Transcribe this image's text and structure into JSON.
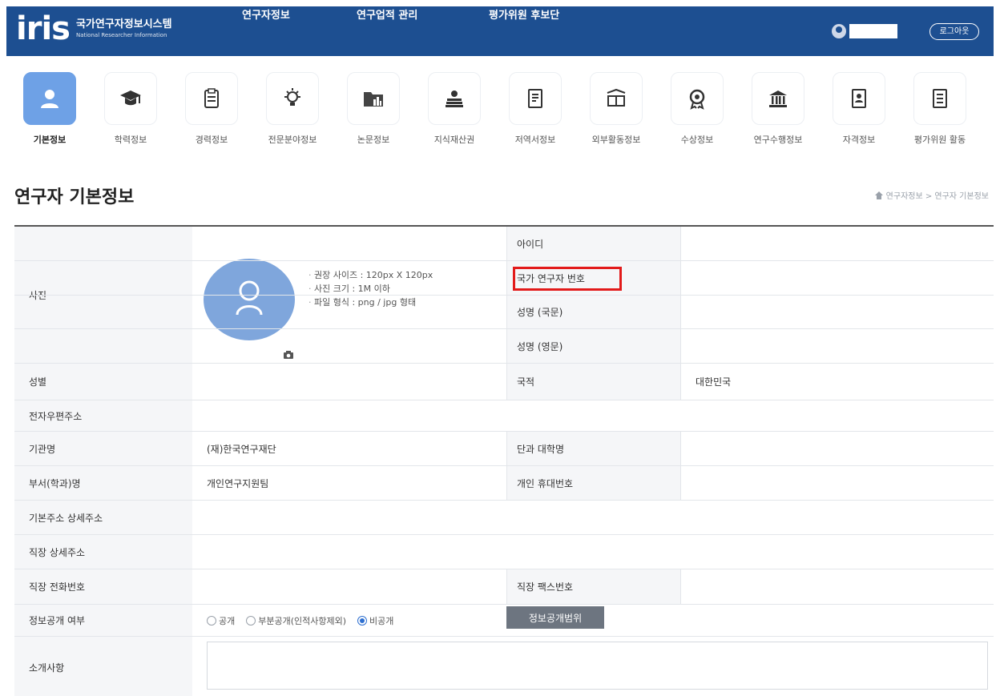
{
  "header": {
    "logo_mark": "iris",
    "logo_ko": "국가연구자정보시스템",
    "logo_en": "National Researcher Information",
    "nav": [
      {
        "label": "연구자정보"
      },
      {
        "label": "연구업적 관리"
      },
      {
        "label": "평가위원 후보단"
      }
    ],
    "logout_label": "로그아웃",
    "colors": {
      "bar": "#1d4f91"
    }
  },
  "categories": [
    {
      "label": "기본정보",
      "icon": "user-icon",
      "active": true
    },
    {
      "label": "학력정보",
      "icon": "graduation-cap-icon"
    },
    {
      "label": "경력정보",
      "icon": "clipboard-icon"
    },
    {
      "label": "전문분야정보",
      "icon": "lightbulb-icon"
    },
    {
      "label": "논문정보",
      "icon": "folder-chart-icon"
    },
    {
      "label": "지식재산권",
      "icon": "books-icon"
    },
    {
      "label": "저역서정보",
      "icon": "book-icon"
    },
    {
      "label": "외부활동정보",
      "icon": "open-book-icon"
    },
    {
      "label": "수상정보",
      "icon": "award-icon"
    },
    {
      "label": "연구수행정보",
      "icon": "institution-icon"
    },
    {
      "label": "자격정보",
      "icon": "id-card-icon"
    },
    {
      "label": "평가위원 활동",
      "icon": "list-document-icon"
    }
  ],
  "page": {
    "title": "연구자 기본정보",
    "breadcrumb": "연구자정보 > 연구자 기본정보"
  },
  "form": {
    "photo_label": "사진",
    "photo_notes": [
      "권장 사이즈 : 120px X 120px",
      "사진 크기 : 1M 이하",
      "파일 형식 : png / jpg 형태"
    ],
    "id_label": "아이디",
    "national_id_label": "국가 연구자 번호",
    "name_ko_label": "성명 (국문)",
    "name_en_label": "성명 (영문)",
    "gender_label": "성별",
    "nationality_label": "국적",
    "nationality_value": "대한민국",
    "email_label": "전자우편주소",
    "org_label": "기관명",
    "org_value": "(재)한국연구재단",
    "college_label": "단과 대학명",
    "dept_label": "부서(학과)명",
    "dept_value": "개인연구지원팀",
    "mobile_label": "개인 휴대번호",
    "home_address_label": "기본주소 상세주소",
    "work_address_label": "직장 상세주소",
    "work_phone_label": "직장 전화번호",
    "work_fax_label": "직장 팩스번호",
    "disclosure_label": "정보공개 여부",
    "disclosure_options": [
      {
        "label": "공개",
        "selected": false
      },
      {
        "label": "부분공개(인적사항제외)",
        "selected": false
      },
      {
        "label": "비공개",
        "selected": true
      }
    ],
    "disclosure_scope_button": "정보공개범위",
    "intro_label": "소개사항"
  }
}
